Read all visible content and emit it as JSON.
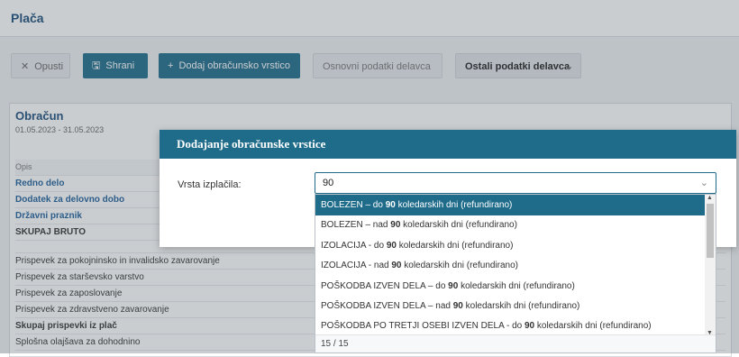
{
  "header": {
    "title": "Plača"
  },
  "toolbar": {
    "cancel_label": "Opusti",
    "save_label": "Shrani",
    "add_label": "Dodaj obračunsko vrstico",
    "basic_label": "Osnovni podatki delavca",
    "other_label": "Ostali podatki delavca"
  },
  "section": {
    "title": "Obračun",
    "date": "01.05.2023 - 31.05.2023",
    "rows": [
      {
        "text": "Opis",
        "kind": "head"
      },
      {
        "text": "Redno delo",
        "kind": "link"
      },
      {
        "text": "Dodatek za delovno dobo",
        "kind": "link"
      },
      {
        "text": "Državni praznik",
        "kind": "link"
      },
      {
        "text": "SKUPAJ BRUTO",
        "kind": "bold"
      },
      {
        "text": "",
        "kind": "gap"
      },
      {
        "text": "Prispevek za pokojninsko in invalidsko zavarovanje",
        "kind": "plain"
      },
      {
        "text": "Prispevek za starševsko varstvo",
        "kind": "plain"
      },
      {
        "text": "Prispevek za zaposlovanje",
        "kind": "plain"
      },
      {
        "text": "Prispevek za zdravstveno zavarovanje",
        "kind": "plain"
      },
      {
        "text": "Skupaj prispevki iz plač",
        "kind": "bold"
      },
      {
        "text": "Splošna olajšava za dohodnino",
        "kind": "plain"
      }
    ]
  },
  "modal": {
    "title": "Dodajanje obračunske vrstice",
    "field_label": "Vrsta izplačila:",
    "field_value": "90"
  },
  "dropdown": {
    "options": [
      {
        "pre": "BOLEZEN – do ",
        "hl": "90",
        "post": " koledarskih dni (refundirano)"
      },
      {
        "pre": "BOLEZEN – nad ",
        "hl": "90",
        "post": " koledarskih dni (refundirano)"
      },
      {
        "pre": "IZOLACIJA - do ",
        "hl": "90",
        "post": " koledarskih dni (refundirano)"
      },
      {
        "pre": "IZOLACIJA - nad ",
        "hl": "90",
        "post": " koledarskih dni (refundirano)"
      },
      {
        "pre": "POŠKODBA IZVEN DELA – do ",
        "hl": "90",
        "post": " koledarskih dni (refundirano)"
      },
      {
        "pre": "POŠKODBA IZVEN DELA – nad ",
        "hl": "90",
        "post": " koledarskih dni (refundirano)"
      },
      {
        "pre": "POŠKODBA PO TRETJI OSEBI IZVEN DELA - do ",
        "hl": "90",
        "post": " koledarskih dni (refundirano)"
      }
    ],
    "count": "15 / 15"
  }
}
